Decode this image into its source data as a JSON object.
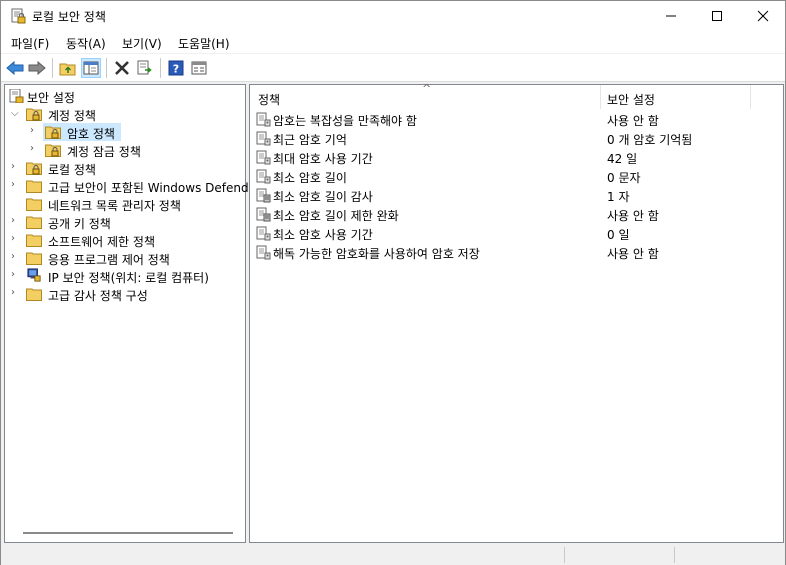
{
  "window": {
    "title": "로컬 보안 정책"
  },
  "menu": [
    {
      "label": "파일(F)"
    },
    {
      "label": "동작(A)"
    },
    {
      "label": "보기(V)"
    },
    {
      "label": "도움말(H)"
    }
  ],
  "toolbar": {
    "buttons": [
      "back-icon",
      "forward-icon",
      "up-folder-icon",
      "show-hide-tree-icon",
      "delete-icon",
      "export-list-icon",
      "help-icon",
      "properties-icon"
    ]
  },
  "tree": {
    "root": "보안 설정",
    "items": [
      {
        "label": "계정 정책",
        "expanded": true
      },
      {
        "label": "암호 정책",
        "selected": true
      },
      {
        "label": "계정 잠금 정책"
      },
      {
        "label": "로컬 정책"
      },
      {
        "label": "고급 보안이 포함된 Windows Defend"
      },
      {
        "label": "네트워크 목록 관리자 정책"
      },
      {
        "label": "공개 키 정책"
      },
      {
        "label": "소프트웨어 제한 정책"
      },
      {
        "label": "응용 프로그램 제어 정책"
      },
      {
        "label": "IP 보안 정책(위치: 로컬 컴퓨터)"
      },
      {
        "label": "고급 감사 정책 구성"
      }
    ]
  },
  "list": {
    "columns": {
      "policy": "정책",
      "setting": "보안 설정"
    },
    "rows": [
      {
        "name": "암호는 복잡성을 만족해야 함",
        "value": "사용 안 함",
        "icon": "policy-icon"
      },
      {
        "name": "최근 암호 기억",
        "value": "0 개 암호 기억됨",
        "icon": "policy-icon"
      },
      {
        "name": "최대 암호 사용 기간",
        "value": "42 일",
        "icon": "policy-icon"
      },
      {
        "name": "최소 암호 길이",
        "value": "0 문자",
        "icon": "policy-icon"
      },
      {
        "name": "최소 암호 길이 감사",
        "value": "1 자",
        "icon": "policy-audit-icon"
      },
      {
        "name": "최소 암호 길이 제한 완화",
        "value": "사용 안 함",
        "icon": "policy-audit-icon"
      },
      {
        "name": "최소 암호 사용 기간",
        "value": "0 일",
        "icon": "policy-icon"
      },
      {
        "name": "해독 가능한 암호화를 사용하여 암호 저장",
        "value": "사용 안 함",
        "icon": "policy-icon"
      }
    ]
  }
}
